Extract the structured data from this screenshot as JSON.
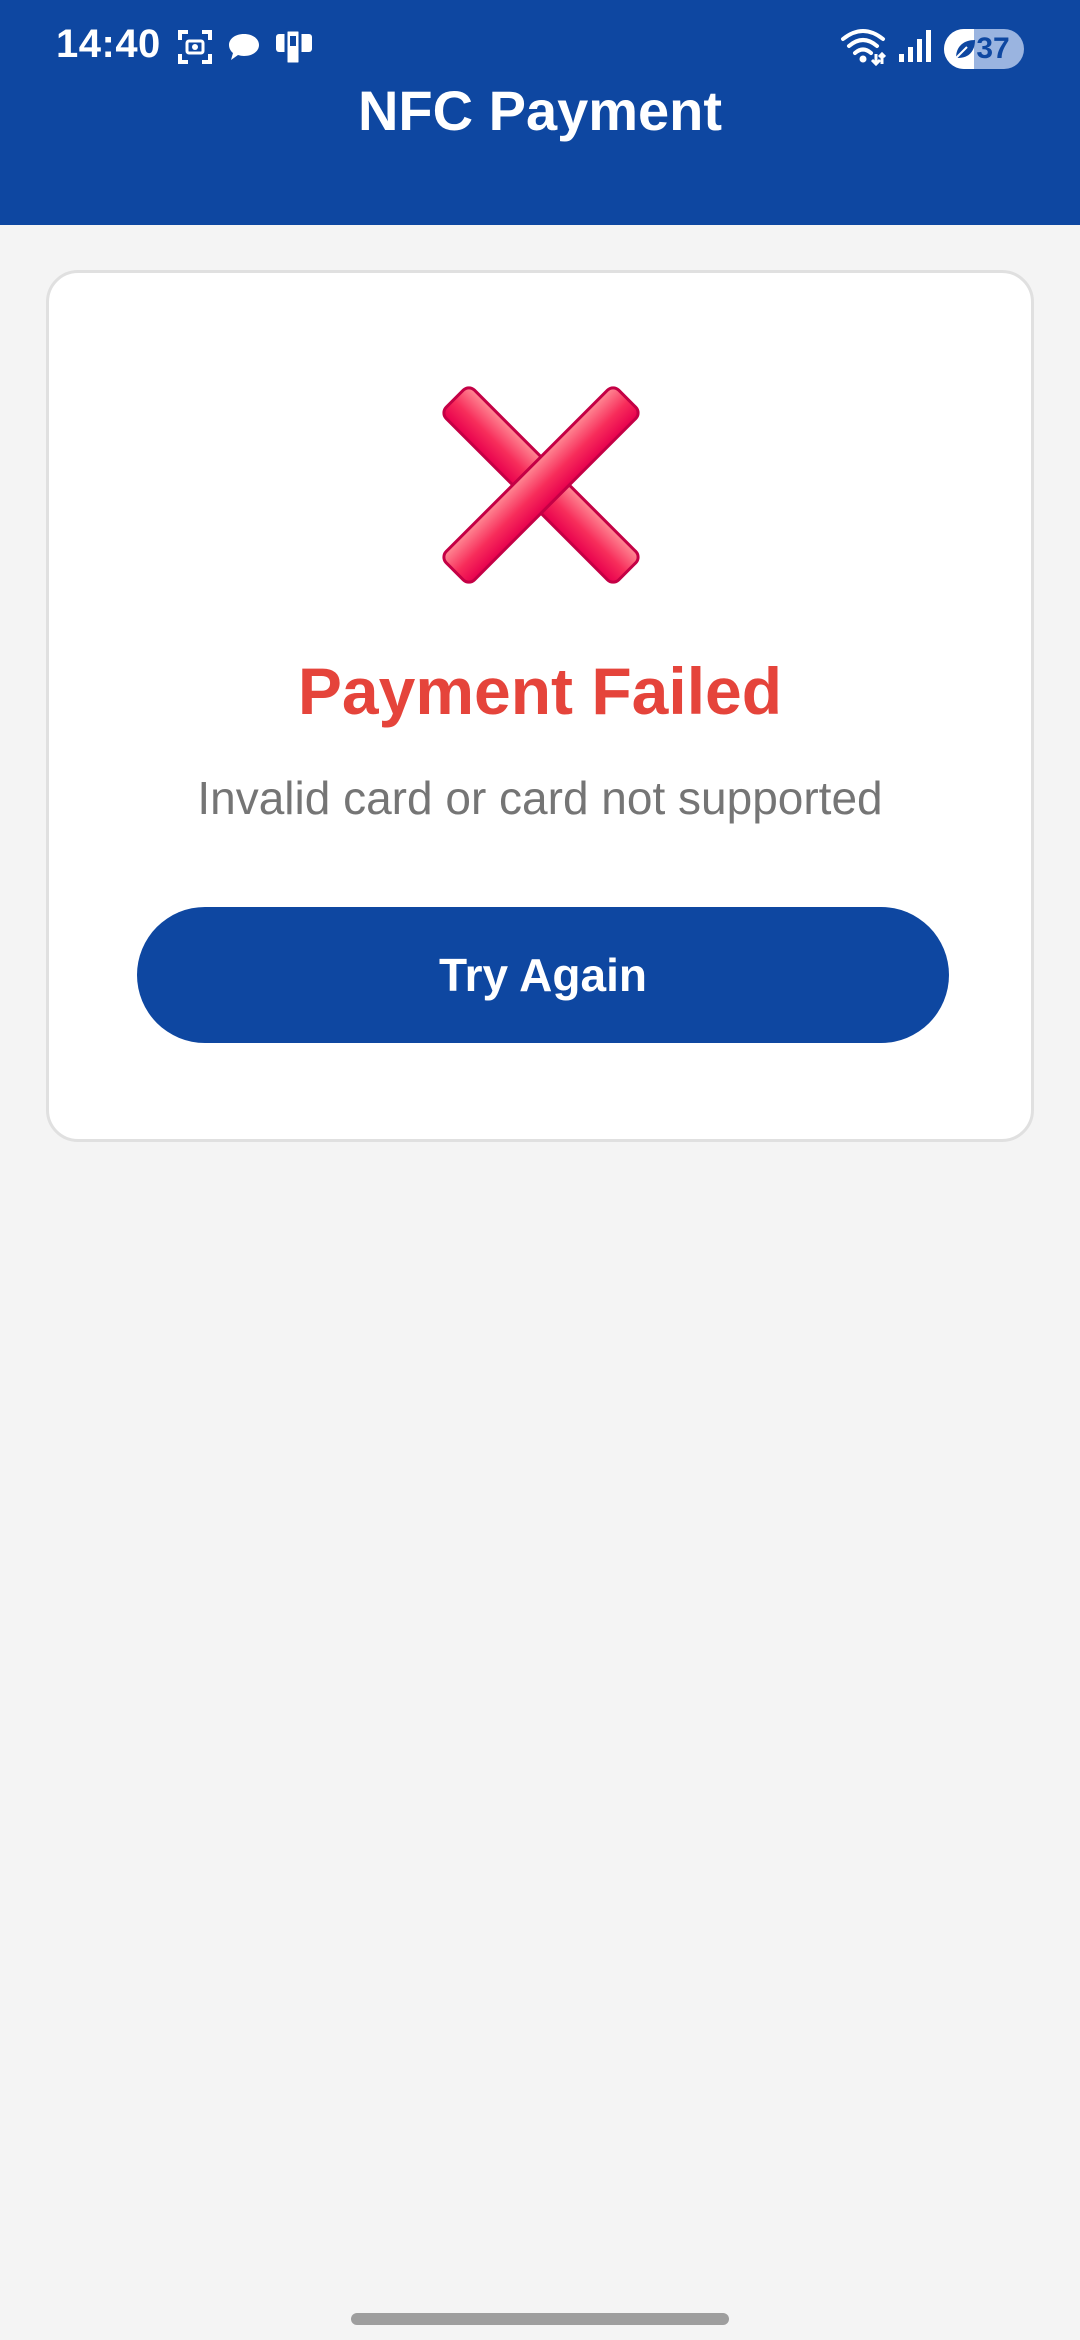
{
  "status_bar": {
    "time": "14:40",
    "battery_level": "37",
    "battery_fraction": 0.37,
    "left_icons": [
      "screenshot-icon",
      "chat-bubble-icon",
      "nfc-reader-icon"
    ],
    "right_icons": [
      "wifi-icon",
      "signal-icon",
      "battery-saver-icon"
    ]
  },
  "header": {
    "title": "NFC Payment",
    "background_color": "#0e47a1"
  },
  "result_card": {
    "icon": "cross-mark-icon",
    "title": "Payment Failed",
    "message": "Invalid card or card not supported",
    "button_label": "Try Again",
    "title_color": "#e5443b",
    "button_color": "#0e47a1"
  }
}
